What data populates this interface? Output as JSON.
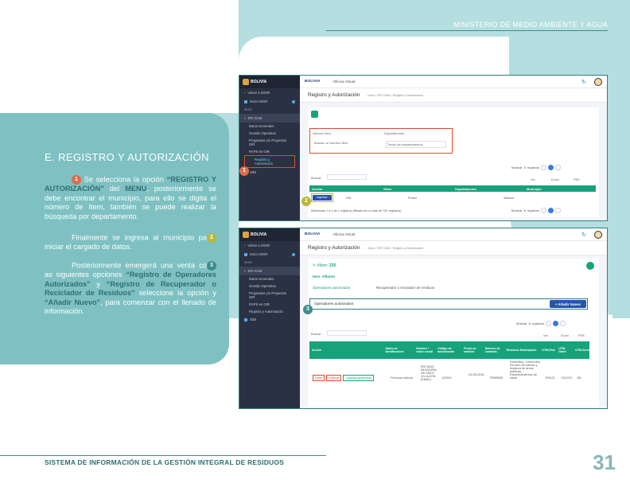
{
  "header": {
    "ministry": "MINISTERIO DE MEDIO AMBIENTE Y AGUA"
  },
  "section": {
    "title": "E. REGISTRO Y AUTORIZACIÓN",
    "p1_a": "Se selecciona la opción ",
    "p1_b": "“REGISTRO Y AUTORIZACIÓN”",
    "p1_c": " del ",
    "p1_d": "MENU",
    "p1_e": ", posteriormente se debe encontrar el municipio, para ello se digita el número de ítem, también se puede realizar la búsqueda por departamento.",
    "p2_a": "Finalmente se ingresa al municipio pa",
    "p2_b": "iniciar el cargado de datos.",
    "p3_a": "Posteriormente emergerá una venta co",
    "p3_b": "as siguientes opciones ",
    "p3_c": "“Registro de Operadores Autorizados”",
    "p3_d": " y ",
    "p3_e": "“Registro de Recuperador o Reciclador de Residuos”",
    "p3_f": " seleccione la opción y ",
    "p3_g": "“Añadir Nuevo”",
    "p3_h": ", para comenzar con el llenado de información."
  },
  "markers": {
    "one": "1",
    "two": "2",
    "three": "3"
  },
  "shot1": {
    "brand": "BOLIVIA",
    "oficina": "Oficina Virtual",
    "sidebar": [
      "Volver a SIGIR",
      "Inicio SIGIR",
      "SIGIR",
      "SRI GAM",
      "Datos Generales",
      "Gestión Operativa",
      "Programas y/o Proyectos GIR",
      "RAPS en GIR",
      "Registro y Autorización",
      "SIDI"
    ],
    "page_title": "Registro y Autorización",
    "breadcrumb": "Inicio / SRI GAM / Registro y Autorización",
    "f_num_label": "Número Ítem",
    "f_num_placeholder": "Buscar un Número Ítem",
    "f_dep_label": "Departamento",
    "f_dep_value": "Todos los departamentos",
    "mostrar": "Mostrar",
    "mostrar_n": "8",
    "registros": "registros",
    "buscar": "Buscar:",
    "ver": "Ver",
    "excel": "Excel",
    "pdf": "PDF",
    "cols": [
      "Acción",
      "#Ítem",
      "Departamento",
      "Municipio"
    ],
    "row": {
      "action": "Ingresar",
      "item": "235",
      "dep": "Potosí",
      "mun": "Villazón"
    },
    "footer_info": "Mostrando 1 a 1 de 1 registros (filtrado de un total de 337 registros)",
    "page": "1"
  },
  "shot2": {
    "brand": "BOLIVIA",
    "oficina": "Oficina Virtual",
    "sidebar": [
      "Volver a SIGIR",
      "Inicio SIGIR",
      "SIGIR",
      "SRI GAM",
      "Datos Generales",
      "Gestión Operativa",
      "Programas y/o Proyectos GIR",
      "RAPS en GIR",
      "Registro y Autorización",
      "SIDI"
    ],
    "page_title": "Registro y Autorización",
    "breadcrumb": "Inicio / SRI GAM / Registro y Autorización",
    "item_label": "#Ítem:",
    "item_value": "235",
    "item_name": "Item: Villazón",
    "tab1": "Operadores autorizados",
    "tab2": "Recuperador o reciclador de residuos",
    "section_label": "Operadores autorizados",
    "add_button": "+ Añadir Nuevo",
    "mostrar": "Mostrar",
    "mostrar_n": "8",
    "registros": "registros",
    "buscar": "Buscar:",
    "ver": "Ver",
    "excel": "Excel",
    "pdf": "PDF",
    "cols": [
      "Acción",
      "Datos de Identificación",
      "Nombre / razón social",
      "Código de autorización",
      "Fecha de emisión",
      "Número de contacto",
      "Residuos Municipales",
      "UTM-Este",
      "UTM-Norte",
      "UTM-Zona"
    ],
    "row": {
      "edit": "Editar",
      "del": "Eliminar",
      "cant": "Cantidad gestionada",
      "ident": "Personal natural",
      "name": "ENTIDAD MUNICIPAL DE ASEO VILLAZON (EMAV)",
      "code": "123200",
      "date": "23-05-2018",
      "phone": "73555555",
      "residuos": "Domicilios, Comercios, Servicio de barrido y limpieza de áreas públicas, Establecimientos de salud",
      "este": "193121",
      "norte": "7411222",
      "zona": "19L"
    }
  },
  "footer": {
    "system": "SISTEMA DE  INFORMACIÓN DE LA GESTIÓN INTEGRAL DE RESIDUOS",
    "page": "31"
  }
}
